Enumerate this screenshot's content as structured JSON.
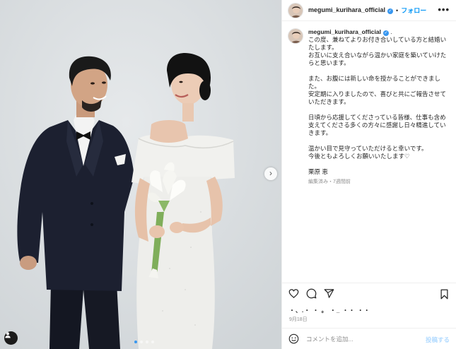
{
  "header": {
    "username": "megumi_kurihara_official",
    "separator": "•",
    "follow_label": "フォロー",
    "more_label": "•••"
  },
  "caption": {
    "username": "megumi_kurihara_official",
    "suffix": ".",
    "text": "この度、兼ねてよりお付き合いしている方と結婚いたします。\nお互いに支え合いながら温かい家庭を築いていけたらと思います。\n\nまた、お腹には新しい命を授かることができました。\n安定期に入りましたので、喜びと共にご報告させていただきます。\n\n日頃から応援してくださっている皆様、仕事も含め支えてくださる多くの方々に感謝し日々精進していきます。\n\n温かい目で見守っていただけると幸いです。\n今後ともよろしくお願いいたします♡\n\n栗原 恵",
    "meta": "編集済み・7週間前"
  },
  "actions": {
    "icons": [
      "heart-icon",
      "comment-icon",
      "share-icon",
      "bookmark-icon"
    ]
  },
  "likes_text": "・、.・ ・ 。 ・_ ・・ ・・",
  "date_text": "9月18日",
  "comment": {
    "placeholder": "コメントを追加...",
    "post_label": "投稿する"
  },
  "photo": {
    "next_label": "›",
    "slides": 4,
    "active_slide": 1
  },
  "colors": {
    "accent": "#0095f6",
    "verified": "#3897f0",
    "muted": "#8e8e8e"
  }
}
